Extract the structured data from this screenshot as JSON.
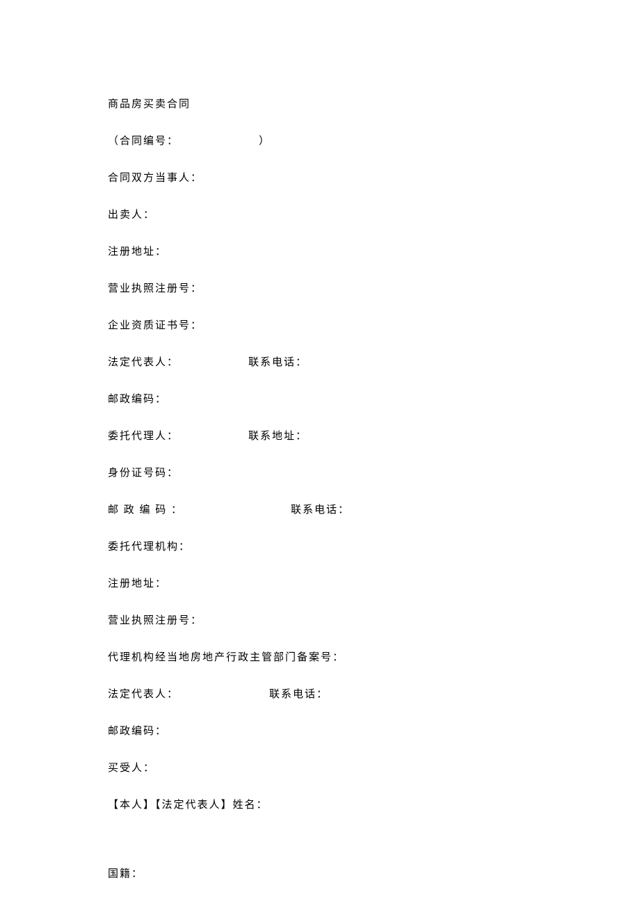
{
  "title": "商品房买卖合同",
  "contract_no_label": "（合同编号：",
  "contract_no_close": "）",
  "parties_label": "合同双方当事人：",
  "seller_label": "出卖人：",
  "reg_address_label": "注册地址：",
  "biz_license_label": "营业执照注册号：",
  "qualification_label": "企业资质证书号：",
  "legal_rep_label": "法定代表人：",
  "phone_label": "联系电话：",
  "postal_label": "邮政编码：",
  "postal_label2": "邮 政 编 码 ：",
  "agent_label": "委托代理人：",
  "contact_address_label": "联系地址：",
  "id_label": "身份证号码：",
  "agent_org_label": "委托代理机构：",
  "reg_address_label2": "注册地址：",
  "biz_license_label2": "营业执照注册号：",
  "filing_label": "代理机构经当地房地产行政主管部门备案号：",
  "legal_rep_label2": "法定代表人：",
  "postal_label3": "邮政编码：",
  "buyer_label": "买受人：",
  "name_label": "【本人】【法定代表人】姓名：",
  "nationality_label": "国籍："
}
